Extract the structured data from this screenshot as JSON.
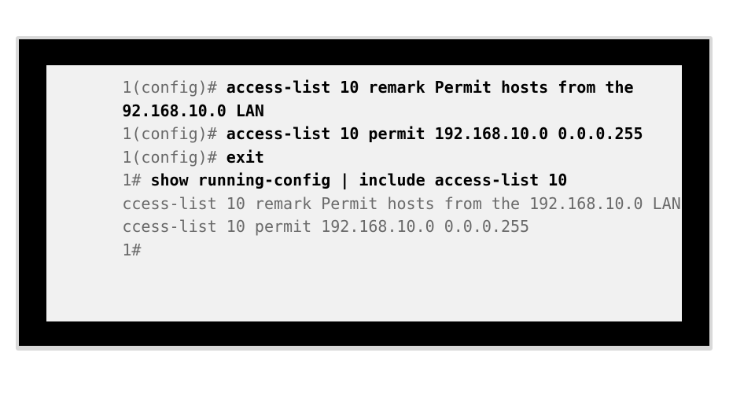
{
  "terminal": {
    "lines": [
      {
        "prompt": "1(config)# ",
        "command": "access-list 10 remark Permit hosts from the"
      },
      {
        "prompt": "",
        "command": "92.168.10.0 LAN"
      },
      {
        "prompt": "1(config)# ",
        "command": "access-list 10 permit 192.168.10.0 0.0.0.255"
      },
      {
        "prompt": "1(config)# ",
        "command": "exit"
      },
      {
        "prompt": "1# ",
        "command": "show running-config | include access-list 10"
      },
      {
        "output": "ccess-list 10 remark Permit hosts from the 192.168.10.0 LAN"
      },
      {
        "output": "ccess-list 10 permit 192.168.10.0 0.0.0.255"
      },
      {
        "prompt": "1#"
      }
    ]
  }
}
